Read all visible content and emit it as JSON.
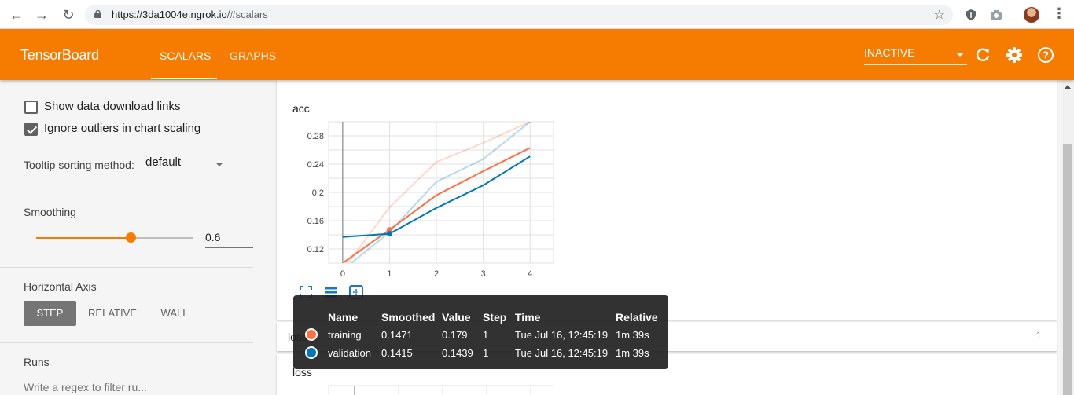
{
  "browser": {
    "url_host": "https://3da1004e.ngrok.io",
    "url_path": "/#scalars"
  },
  "header": {
    "logo": "TensorBoard",
    "tabs": [
      {
        "label": "SCALARS",
        "active": true
      },
      {
        "label": "GRAPHS",
        "active": false
      }
    ],
    "status_select": "INACTIVE",
    "accent_color": "#f57c00"
  },
  "sidebar": {
    "show_download_links": {
      "label": "Show data download links",
      "checked": false
    },
    "ignore_outliers": {
      "label": "Ignore outliers in chart scaling",
      "checked": true
    },
    "tooltip_sorting_label": "Tooltip sorting method:",
    "tooltip_sorting_value": "default",
    "smoothing_label": "Smoothing",
    "smoothing_value": "0.6",
    "smoothing_fraction": 0.6,
    "horizontal_axis_label": "Horizontal Axis",
    "axis_options": [
      {
        "label": "STEP",
        "active": true
      },
      {
        "label": "RELATIVE",
        "active": false
      },
      {
        "label": "WALL",
        "active": false
      }
    ],
    "runs_label": "Runs",
    "runs_filter_placeholder": "Write a regex to filter ru..."
  },
  "main": {
    "acc_card_title": "acc",
    "loss_group_label": "loss",
    "loss_group_count": "1",
    "loss_card_title": "loss"
  },
  "chart_data": {
    "type": "line",
    "title": "acc",
    "xlabel": "",
    "ylabel": "",
    "x_ticks": [
      "0",
      "1",
      "2",
      "3",
      "4"
    ],
    "y_ticks": [
      "0.12",
      "0.16",
      "0.2",
      "0.24",
      "0.28"
    ],
    "xlim": [
      -0.3,
      4.5
    ],
    "ylim": [
      0.1,
      0.3
    ],
    "x": [
      0,
      1,
      2,
      3,
      4
    ],
    "series": [
      {
        "name": "training",
        "color": "#ff7043",
        "smoothed": [
          0.1,
          0.1471,
          0.196,
          0.23,
          0.263
        ],
        "raw": [
          0.09,
          0.179,
          0.243,
          0.27,
          0.3
        ]
      },
      {
        "name": "validation",
        "color": "#0077bb",
        "smoothed": [
          0.137,
          0.1415,
          0.178,
          0.21,
          0.251
        ],
        "raw": [
          0.09,
          0.1439,
          0.215,
          0.247,
          0.3
        ]
      }
    ],
    "highlight_x": 1
  },
  "tooltip": {
    "headers": [
      "Name",
      "Smoothed",
      "Value",
      "Step",
      "Time",
      "Relative"
    ],
    "rows": [
      {
        "color": "#ff7043",
        "name": "training",
        "smoothed": "0.1471",
        "value": "0.179",
        "step": "1",
        "time": "Tue Jul 16, 12:45:19",
        "relative": "1m 39s"
      },
      {
        "color": "#0077bb",
        "name": "validation",
        "smoothed": "0.1415",
        "value": "0.1439",
        "step": "1",
        "time": "Tue Jul 16, 12:45:19",
        "relative": "1m 39s"
      }
    ]
  }
}
